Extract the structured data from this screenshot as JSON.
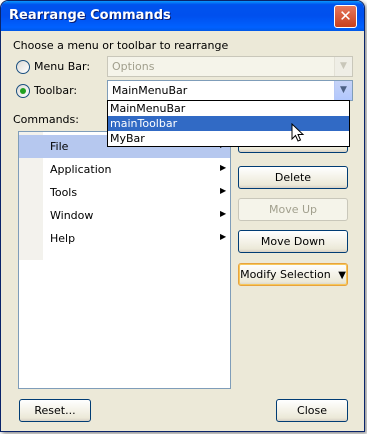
{
  "window": {
    "title": "Rearrange Commands",
    "close_label": "✕"
  },
  "prompt": "Choose a menu or toolbar to rearrange",
  "menubar_option": {
    "label": "Menu Bar:",
    "selected": false,
    "value": "Options"
  },
  "toolbar_option": {
    "label": "Toolbar:",
    "selected": true,
    "value": "MainMenuBar"
  },
  "commands_label": "Commands:",
  "commands": [
    {
      "label": "File",
      "arrow": "▶",
      "selected": true
    },
    {
      "label": "Application",
      "arrow": "▶",
      "selected": false
    },
    {
      "label": "Tools",
      "arrow": "▶",
      "selected": false
    },
    {
      "label": "Window",
      "arrow": "▶",
      "selected": false
    },
    {
      "label": "Help",
      "arrow": "▶",
      "selected": false
    }
  ],
  "dropdown_options": [
    {
      "label": "MainMenuBar",
      "highlighted": false
    },
    {
      "label": "mainToolbar",
      "highlighted": true
    },
    {
      "label": "MyBar",
      "highlighted": false
    }
  ],
  "buttons": {
    "delete": "Delete",
    "move_up": "Move Up",
    "move_down": "Move Down",
    "modify_selection": "Modify Selection",
    "reset": "Reset...",
    "close": "Close"
  },
  "icons": {
    "dropdown_arrow": "chevron-down-icon",
    "submenu_arrow": "triangle-right-icon",
    "cursor": "mouse-pointer-icon"
  },
  "colors": {
    "title_bar": "#0053ee",
    "selection": "#316ac5",
    "radio_dot": "#21a121"
  }
}
